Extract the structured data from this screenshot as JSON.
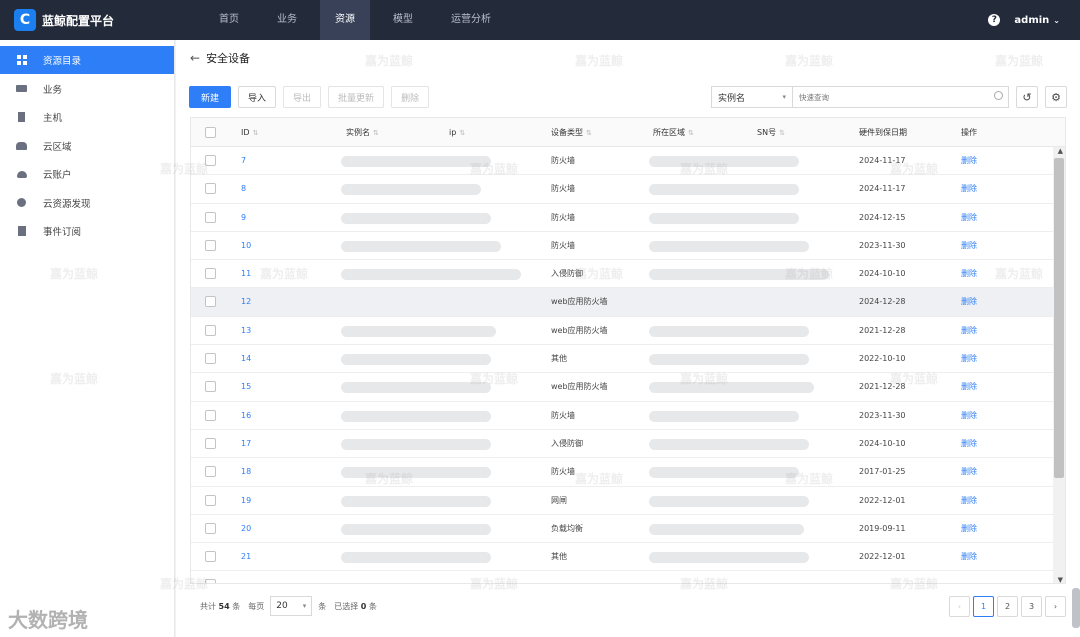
{
  "app": {
    "logo_letter": "C",
    "title": "蓝鲸配置平台"
  },
  "nav": {
    "items": [
      "首页",
      "业务",
      "资源",
      "模型",
      "运营分析"
    ],
    "active": "资源"
  },
  "user": {
    "help": "?",
    "name": "admin",
    "chevron": "⌄"
  },
  "sidebar": {
    "items": [
      {
        "label": "资源目录",
        "icon": "grid-icon",
        "active": true
      },
      {
        "label": "业务",
        "icon": "briefcase-icon"
      },
      {
        "label": "主机",
        "icon": "server-icon"
      },
      {
        "label": "云区域",
        "icon": "cloud-area-icon"
      },
      {
        "label": "云账户",
        "icon": "cloud-account-icon"
      },
      {
        "label": "云资源发现",
        "icon": "discover-icon"
      },
      {
        "label": "事件订阅",
        "icon": "bookmark-icon"
      }
    ]
  },
  "page": {
    "back": "←",
    "title": "安全设备"
  },
  "toolbar": {
    "new": "新建",
    "import": "导入",
    "export": "导出",
    "batch_update": "批量更新",
    "delete": "删除"
  },
  "search": {
    "field": "实例名",
    "placeholder": "快速查询",
    "history_icon": "↺",
    "settings_icon": "⚙"
  },
  "table": {
    "columns": [
      "ID",
      "实例名",
      "ip",
      "设备类型",
      "所在区域",
      "SN号",
      "硬件到保日期",
      "操作"
    ],
    "rows": [
      {
        "id": "7",
        "type": "防火墙",
        "date": "2024-11-17",
        "op": "删除"
      },
      {
        "id": "8",
        "type": "防火墙",
        "date": "2024-11-17",
        "op": "删除"
      },
      {
        "id": "9",
        "type": "防火墙",
        "date": "2024-12-15",
        "op": "删除"
      },
      {
        "id": "10",
        "type": "防火墙",
        "date": "2023-11-30",
        "op": "删除"
      },
      {
        "id": "11",
        "type": "入侵防御",
        "date": "2024-10-10",
        "op": "删除"
      },
      {
        "id": "12",
        "type": "web应用防火墙",
        "date": "2024-12-28",
        "op": "删除"
      },
      {
        "id": "13",
        "type": "web应用防火墙",
        "date": "2021-12-28",
        "op": "删除"
      },
      {
        "id": "14",
        "type": "其他",
        "date": "2022-10-10",
        "op": "删除"
      },
      {
        "id": "15",
        "type": "web应用防火墙",
        "date": "2021-12-28",
        "op": "删除"
      },
      {
        "id": "16",
        "type": "防火墙",
        "date": "2023-11-30",
        "op": "删除"
      },
      {
        "id": "17",
        "type": "入侵防御",
        "date": "2024-10-10",
        "op": "删除"
      },
      {
        "id": "18",
        "type": "防火墙",
        "date": "2017-01-25",
        "op": "删除"
      },
      {
        "id": "19",
        "type": "网闸",
        "date": "2022-12-01",
        "op": "删除"
      },
      {
        "id": "20",
        "type": "负载均衡",
        "date": "2019-09-11",
        "op": "删除"
      },
      {
        "id": "21",
        "type": "其他",
        "date": "2022-12-01",
        "op": "删除"
      }
    ]
  },
  "footer": {
    "total_prefix": "共计",
    "total": "54",
    "total_suffix": "条",
    "per_page_label": "每页",
    "per_page": "20",
    "per_page_unit": "条",
    "selected_prefix": "已选择",
    "selected": "0",
    "selected_suffix": "条"
  },
  "pagination": {
    "prev": "‹",
    "pages": [
      "1",
      "2",
      "3"
    ],
    "current": "1",
    "next": "›"
  },
  "watermark": {
    "text": "嘉为蓝鲸",
    "brand": "大数跨境"
  }
}
